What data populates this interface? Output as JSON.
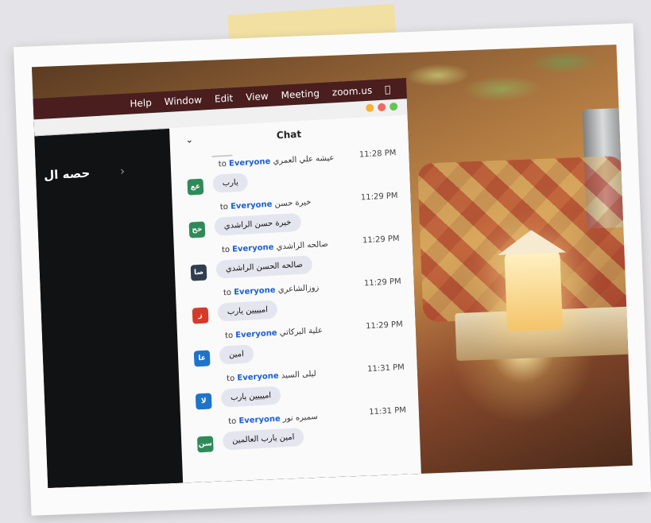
{
  "menu_bar": {
    "items": [
      "zoom.us",
      "Meeting",
      "View",
      "Edit",
      "Window",
      "Help"
    ],
    "apple_icon": "apple-icon"
  },
  "window": {
    "dot_colors": [
      "#f5b33c",
      "#ed6a5e",
      "#61c554"
    ]
  },
  "meeting": {
    "title": "حصه ال"
  },
  "chat": {
    "title": "Chat",
    "messages": [
      {
        "sender": "عيشه علي العمري",
        "to": "to",
        "target": "Everyone",
        "time": "11:28 PM",
        "text": "يارب",
        "initials": "عع",
        "color": "#2e8b57"
      },
      {
        "sender": "خيرة حسن",
        "to": "to",
        "target": "Everyone",
        "time": "11:29 PM",
        "text": "خيرة حسن الراشدي",
        "initials": "خح",
        "color": "#2e8b57"
      },
      {
        "sender": "صالحه الراشدي",
        "to": "to",
        "target": "Everyone",
        "time": "11:29 PM",
        "text": "صالحه الحسن الراشدي",
        "initials": "صا",
        "color": "#2f3e4f"
      },
      {
        "sender": "زوزالشاعري",
        "to": "to",
        "target": "Everyone",
        "time": "11:29 PM",
        "text": "اميييين يارب",
        "initials": "ز",
        "color": "#d43b2b"
      },
      {
        "sender": "علية البركاتي",
        "to": "to",
        "target": "Everyone",
        "time": "11:29 PM",
        "text": "امين",
        "initials": "عا",
        "color": "#1f73c9"
      },
      {
        "sender": "ليلى السيد",
        "to": "to",
        "target": "Everyone",
        "time": "11:31 PM",
        "text": "اميييين يارب",
        "initials": "لا",
        "color": "#1f73c9"
      },
      {
        "sender": "سميره نور",
        "to": "to",
        "target": "Everyone",
        "time": "11:31 PM",
        "text": "امين يارب العالمين",
        "initials": "سن",
        "color": "#2e8b57"
      }
    ]
  }
}
